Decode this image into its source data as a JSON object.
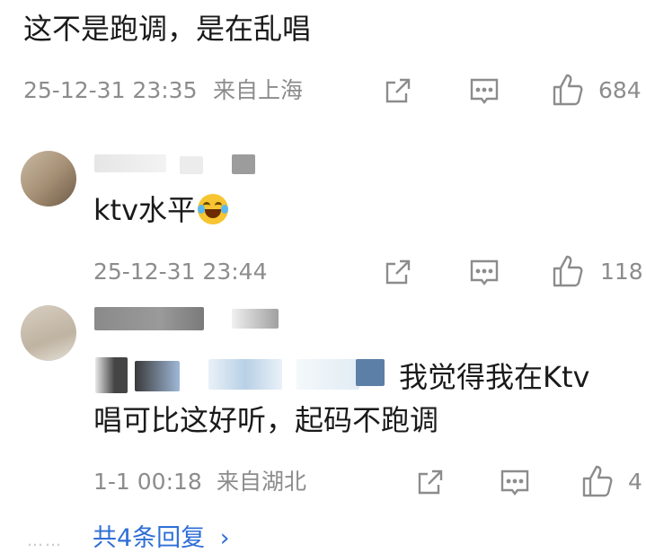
{
  "comment1": {
    "text": "这不是跑调，是在乱唱",
    "date": "25-12-31 23:35",
    "location": "来自上海",
    "likes": "684"
  },
  "reply1": {
    "text": "ktv水平",
    "emoji_icon": "laugh-crying-emoji",
    "date": "25-12-31 23:44",
    "likes": "118"
  },
  "reply2": {
    "text_line1": "我觉得我在Ktv",
    "text_line2": "唱可比这好听，起码不跑调",
    "date": "1-1 00:18",
    "location": "来自湖北",
    "likes": "4"
  },
  "more_replies": {
    "label": "共4条回复",
    "chevron": "›",
    "dots": "……"
  },
  "icons": {
    "share": "share-icon",
    "comment": "comment-icon",
    "like": "thumbs-up-icon"
  },
  "colors": {
    "meta": "#8c8c8c",
    "link": "#2f6fd6"
  }
}
